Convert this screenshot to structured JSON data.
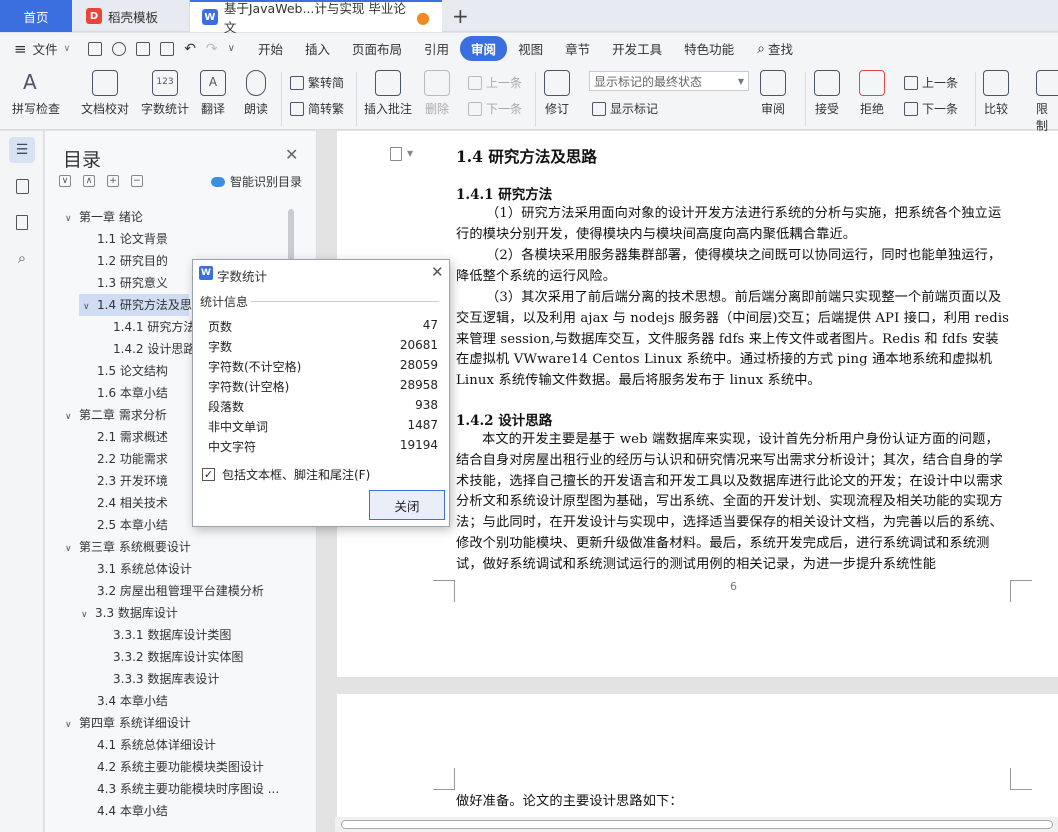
{
  "tabs": [
    {
      "label": "首页"
    },
    {
      "label": "稻壳模板"
    },
    {
      "label": "基于JavaWeb...计与实现 毕业论文"
    }
  ],
  "menubar": {
    "file_label": "文件",
    "tabs": [
      "开始",
      "插入",
      "页面布局",
      "引用",
      "审阅",
      "视图",
      "章节",
      "开发工具",
      "特色功能"
    ],
    "active_tab": "审阅",
    "search_label": "查找"
  },
  "ribbon": {
    "spellcheck": "拼写检查",
    "doc_proof": "文档校对",
    "word_count": "字数统计",
    "translate": "翻译",
    "read_aloud": "朗读",
    "trad_conv": "繁转简",
    "simp_conv": "简转繁",
    "insert_comment": "插入批注",
    "delete": "删除",
    "prev_comment": "上一条",
    "next_comment": "下一条",
    "revise": "修订",
    "markup_select": "显示标记的最终状态",
    "show_markup": "显示标记",
    "review": "审阅",
    "accept": "接受",
    "reject": "拒绝",
    "prev_change": "上一条",
    "next_change": "下一条",
    "compare": "比较",
    "restrict": "限制"
  },
  "toc": {
    "title": "目录",
    "smart_label": "智能识别目录",
    "items": [
      {
        "num": "第一章",
        "label": "绪论"
      },
      {
        "num": "1.1",
        "label": "论文背景"
      },
      {
        "num": "1.2",
        "label": "研究目的"
      },
      {
        "num": "1.3",
        "label": "研究意义"
      },
      {
        "num": "1.4",
        "label": "研究方法及思路"
      },
      {
        "num": "1.4.1",
        "label": "研究方法"
      },
      {
        "num": "1.4.2",
        "label": "设计思路"
      },
      {
        "num": "1.5",
        "label": "论文结构"
      },
      {
        "num": "1.6",
        "label": "本章小结"
      },
      {
        "num": "第二章",
        "label": "需求分析"
      },
      {
        "num": "2.1",
        "label": "需求概述"
      },
      {
        "num": "2.2",
        "label": "功能需求"
      },
      {
        "num": "2.3",
        "label": "开发环境"
      },
      {
        "num": "2.4",
        "label": "相关技术"
      },
      {
        "num": "2.5",
        "label": "本章小结"
      },
      {
        "num": "第三章",
        "label": "系统概要设计"
      },
      {
        "num": "3.1",
        "label": "系统总体设计"
      },
      {
        "num": "3.2",
        "label": "房屋出租管理平台建模分析"
      },
      {
        "num": "3.3",
        "label": "数据库设计"
      },
      {
        "num": "3.3.1",
        "label": "数据库设计类图"
      },
      {
        "num": "3.3.2",
        "label": "数据库设计实体图"
      },
      {
        "num": "3.3.3",
        "label": "数据库表设计"
      },
      {
        "num": "3.4",
        "label": "本章小结"
      },
      {
        "num": "第四章",
        "label": "系统详细设计"
      },
      {
        "num": "4.1",
        "label": "系统总体详细设计"
      },
      {
        "num": "4.2",
        "label": "系统主要功能模块类图设计"
      },
      {
        "num": "4.3",
        "label": "系统主要功能模块时序图设 ..."
      },
      {
        "num": "4.4",
        "label": "本章小结"
      }
    ]
  },
  "document": {
    "h_section": "1.4  研究方法及思路",
    "h_sub1": "1.4.1  研究方法",
    "p1": "（1）研究方法采用面向对象的设计开发方法进行系统的分析与实施，把系统各个独立运行的模块分别开发，使得模块内与模块间高度向高内聚低耦合靠近。",
    "p2": "（2）各模块采用服务器集群部署，使得模块之间既可以协同运行，同时也能单独运行，降低整个系统的运行风险。",
    "p3": "（3）其次采用了前后端分离的技术思想。前后端分离即前端只实现整一个前端页面以及交互逻辑，以及利用 ajax 与 nodejs 服务器（中间层)交互；后端提供 API 接口，利用 redis 来管理 session,与数据库交互，文件服务器 fdfs 来上传文件或者图片。Redis 和 fdfs 安装在虚拟机 VWware14 Centos Linux 系统中。通过桥接的方式 ping 通本地系统和虚拟机 Linux 系统传输文件数据。最后将服务发布于 linux 系统中。",
    "h_sub2": "1.4.2  设计思路",
    "p4": "本文的开发主要是基于 web 端数据库来实现，设计首先分析用户身份认证方面的问题，结合自身对房屋出租行业的经历与认识和研究情况来写出需求分析设计；其次，结合自身的学术技能，选择自己擅长的开发语言和开发工具以及数据库进行此论文的开发；在设计中以需求分析文和系统设计原型图为基础，写出系统、全面的开发计划、实现流程及相关功能的实现方法；与此同时，在开发设计与实现中，选择适当要保存的相关设计文档，为完善以后的系统、修改个别功能模块、更新升级做准备材料。最后，系统开发完成后，进行系统调试和系统测试，做好系统调试和系统测试运行的测试用例的相关记录，为进一步提升系统性能",
    "page_number": "6",
    "p5": "做好准备。论文的主要设计思路如下："
  },
  "dialog": {
    "title": "字数统计",
    "group_label": "统计信息",
    "rows": [
      {
        "label": "页数",
        "value": "47"
      },
      {
        "label": "字数",
        "value": "20681"
      },
      {
        "label": "字符数(不计空格)",
        "value": "28059"
      },
      {
        "label": "字符数(计空格)",
        "value": "28958"
      },
      {
        "label": "段落数",
        "value": "938"
      },
      {
        "label": "非中文单词",
        "value": "1487"
      },
      {
        "label": "中文字符",
        "value": "19194"
      }
    ],
    "checkbox_label": "包括文本框、脚注和尾注(F)",
    "checkbox_checked": true,
    "close_label": "关闭"
  },
  "colors": {
    "accent": "#3b6fe0",
    "toc_selected": "#cfdcf3",
    "unsaved_dot": "#f08a24"
  }
}
